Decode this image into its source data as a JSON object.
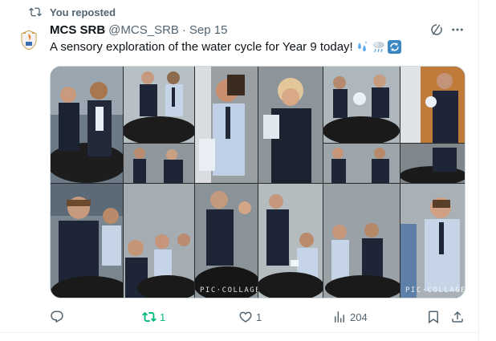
{
  "repost_header": {
    "text": "You reposted",
    "icon": "repost-icon"
  },
  "author": {
    "name": "MCS SRB",
    "handle": "@MCS_SRB",
    "separator": "·",
    "date": "Sep 15",
    "avatar": "school-crest-logo"
  },
  "tweet": {
    "text": "A sensory exploration of the water cycle for Year 9 today!",
    "emojis": [
      "splashing-sweat-emoji",
      "cloud-with-rain-emoji",
      "counterclockwise-arrows-emoji"
    ]
  },
  "media": {
    "watermark": "PIC·COLLAGE",
    "alt": "Collage of students exploring the water cycle"
  },
  "actions": {
    "reply": {
      "icon": "reply-icon",
      "count": ""
    },
    "repost": {
      "icon": "repost-icon",
      "count": "1",
      "color": "#00ba7c"
    },
    "like": {
      "icon": "heart-icon",
      "count": "1"
    },
    "views": {
      "icon": "views-icon",
      "count": "204"
    },
    "bookmark": {
      "icon": "bookmark-icon"
    },
    "share": {
      "icon": "share-icon"
    }
  },
  "colors": {
    "text": "#0f1419",
    "secondary": "#536471",
    "repost_green": "#00ba7c",
    "border": "#cfd9de"
  }
}
